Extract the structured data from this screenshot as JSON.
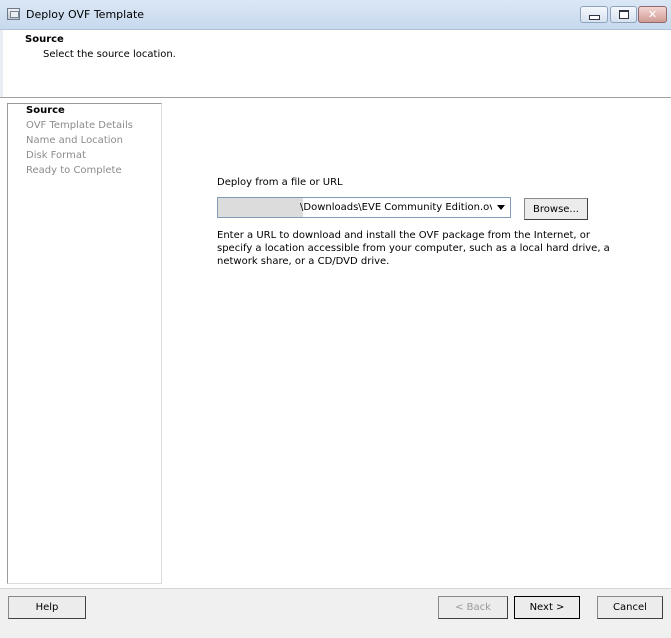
{
  "window": {
    "title": "Deploy OVF Template"
  },
  "header": {
    "title": "Source",
    "subtitle": "Select the source location."
  },
  "steps": [
    {
      "label": "Source",
      "active": true
    },
    {
      "label": "OVF Template Details",
      "active": false
    },
    {
      "label": "Name and Location",
      "active": false
    },
    {
      "label": "Disk Format",
      "active": false
    },
    {
      "label": "Ready to Complete",
      "active": false
    }
  ],
  "main": {
    "deploy_label": "Deploy from a file or URL",
    "source_path": "\\Downloads\\EVE Community Edition.ova",
    "browse_label": "Browse...",
    "description_lines": [
      "Enter a URL to download and install the OVF package from the Internet, or",
      "specify a location accessible from your computer, such as a local hard drive, a",
      "network share, or a CD/DVD drive."
    ]
  },
  "footer": {
    "help_label": "Help",
    "back_label": "< Back",
    "next_label": "Next >",
    "cancel_label": "Cancel"
  },
  "icons": {
    "app": "ovf-template-icon",
    "minimize": "minimize-icon",
    "maximize": "maximize-icon",
    "close": "close-icon",
    "dropdown": "chevron-down-icon"
  }
}
